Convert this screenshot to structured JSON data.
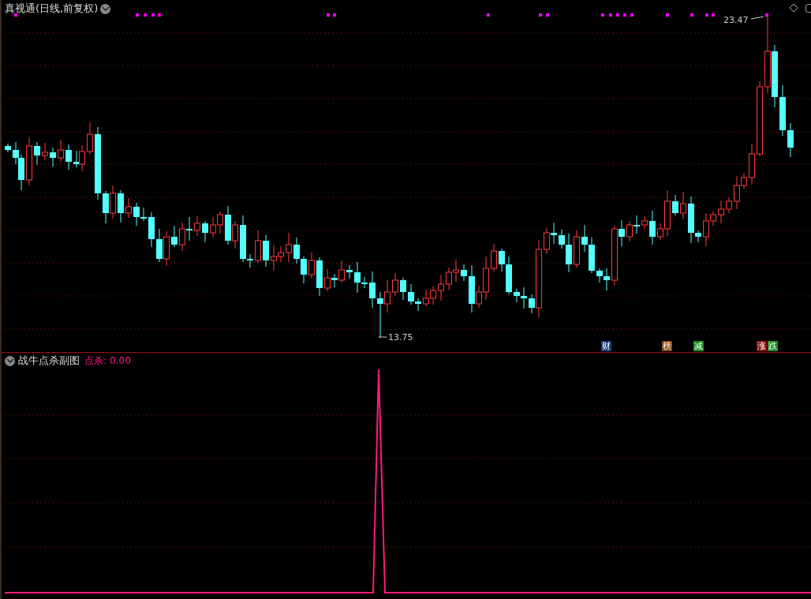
{
  "main_chart": {
    "title": "真视通(日线,前复权)",
    "high_label": "23.47",
    "low_label": "13.75",
    "badges": [
      {
        "text": "财",
        "color": "#1a3f78"
      },
      {
        "text": "榜",
        "color": "#8a4a12"
      },
      {
        "text": "减",
        "color": "#1c8a1c"
      },
      {
        "text": "涨",
        "color": "#8a0f0f"
      },
      {
        "text": "跌",
        "color": "#1c8a1c"
      }
    ]
  },
  "indicator": {
    "name": "战牛点杀副图",
    "series_label": "点杀:",
    "value": "0.00"
  }
}
